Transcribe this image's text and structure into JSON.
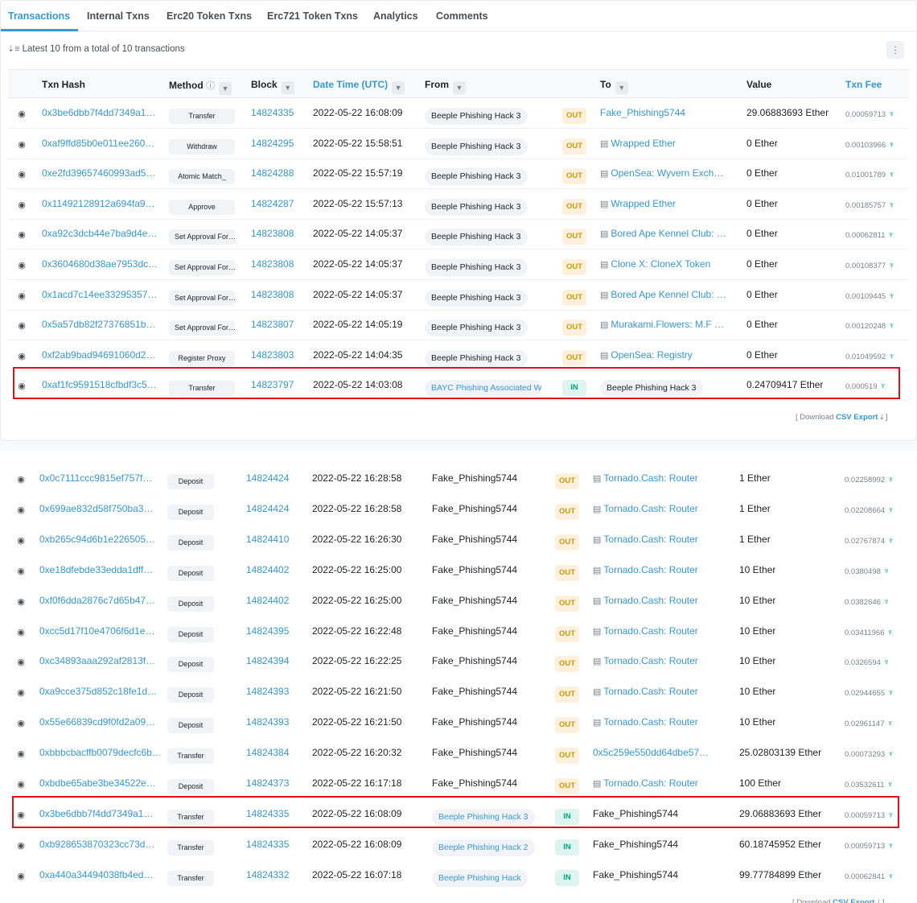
{
  "tabs": [
    "Transactions",
    "Internal Txns",
    "Erc20 Token Txns",
    "Erc721 Token Txns",
    "Analytics",
    "Comments"
  ],
  "summary": "Latest 10 from a total of 10 transactions",
  "headers": {
    "txn_hash": "Txn Hash",
    "method": "Method",
    "block": "Block",
    "datetime": "Date Time (UTC)",
    "from": "From",
    "to": "To",
    "value": "Value",
    "txn_fee": "Txn Fee"
  },
  "download": {
    "prefix": "[ Download",
    "csv": "CSV Export",
    "suffix": "]"
  },
  "colors": {
    "link": "#3498db",
    "out_badge": "#cc9a06",
    "in_badge": "#00a186",
    "highlight": "#e0101a"
  },
  "table1": [
    {
      "hash": "0x3be6dbb7f4dd7349a1…",
      "method": "Transfer",
      "block": "14824335",
      "datetime": "2022-05-22 16:08:09",
      "from": "Beeple Phishing Hack 3",
      "dir": "OUT",
      "to": "Fake_Phishing5744",
      "to_contract": false,
      "value": "29.06883693 Ether",
      "fee": "0.00059713"
    },
    {
      "hash": "0xaf9ffd85b0e011ee260…",
      "method": "Withdraw",
      "block": "14824295",
      "datetime": "2022-05-22 15:58:51",
      "from": "Beeple Phishing Hack 3",
      "dir": "OUT",
      "to": "Wrapped Ether",
      "to_contract": true,
      "value": "0 Ether",
      "fee": "0.00103966"
    },
    {
      "hash": "0xe2fd39657460993ad5…",
      "method": "Atomic Match_",
      "block": "14824288",
      "datetime": "2022-05-22 15:57:19",
      "from": "Beeple Phishing Hack 3",
      "dir": "OUT",
      "to": "OpenSea: Wyvern Exch…",
      "to_contract": true,
      "value": "0 Ether",
      "fee": "0.01001789"
    },
    {
      "hash": "0x11492128912a694fa9…",
      "method": "Approve",
      "block": "14824287",
      "datetime": "2022-05-22 15:57:13",
      "from": "Beeple Phishing Hack 3",
      "dir": "OUT",
      "to": "Wrapped Ether",
      "to_contract": true,
      "value": "0 Ether",
      "fee": "0.00185757"
    },
    {
      "hash": "0xa92c3dcb44e7ba9d4e…",
      "method": "Set Approval For…",
      "block": "14823808",
      "datetime": "2022-05-22 14:05:37",
      "from": "Beeple Phishing Hack 3",
      "dir": "OUT",
      "to": "Bored Ape Kennel Club: …",
      "to_contract": true,
      "value": "0 Ether",
      "fee": "0.00062811"
    },
    {
      "hash": "0x3604680d38ae7953dc…",
      "method": "Set Approval For…",
      "block": "14823808",
      "datetime": "2022-05-22 14:05:37",
      "from": "Beeple Phishing Hack 3",
      "dir": "OUT",
      "to": "Clone X: CloneX Token",
      "to_contract": true,
      "value": "0 Ether",
      "fee": "0.00108377"
    },
    {
      "hash": "0x1acd7c14ee33295357…",
      "method": "Set Approval For…",
      "block": "14823808",
      "datetime": "2022-05-22 14:05:37",
      "from": "Beeple Phishing Hack 3",
      "dir": "OUT",
      "to": "Bored Ape Kennel Club: …",
      "to_contract": true,
      "value": "0 Ether",
      "fee": "0.00109445"
    },
    {
      "hash": "0x5a57db82f27376851b…",
      "method": "Set Approval For…",
      "block": "14823807",
      "datetime": "2022-05-22 14:05:19",
      "from": "Beeple Phishing Hack 3",
      "dir": "OUT",
      "to": "Murakami.Flowers: M.F …",
      "to_contract": true,
      "value": "0 Ether",
      "fee": "0.00120248"
    },
    {
      "hash": "0xf2ab9bad94691060d2…",
      "method": "Register Proxy",
      "block": "14823803",
      "datetime": "2022-05-22 14:04:35",
      "from": "Beeple Phishing Hack 3",
      "dir": "OUT",
      "to": "OpenSea: Registry",
      "to_contract": true,
      "value": "0 Ether",
      "fee": "0.01049592"
    },
    {
      "hash": "0xaf1fc9591518cfbdf3c5…",
      "method": "Transfer",
      "block": "14823797",
      "datetime": "2022-05-22 14:03:08",
      "from": "BAYC Phishing Associated W…",
      "from_link": true,
      "dir": "IN",
      "to": "Beeple Phishing Hack 3",
      "to_pill": true,
      "value": "0.24709417 Ether",
      "fee": "0.000519",
      "highlight": true
    }
  ],
  "table2": [
    {
      "hash": "0x0c7111ccc9815ef757f…",
      "method": "Deposit",
      "block": "14824424",
      "datetime": "2022-05-22 16:28:58",
      "from": "Fake_Phishing5744",
      "dir": "OUT",
      "to": "Tornado.Cash: Router",
      "to_contract": true,
      "value": "1 Ether",
      "fee": "0.02258992"
    },
    {
      "hash": "0x699ae832d58f750ba3…",
      "method": "Deposit",
      "block": "14824424",
      "datetime": "2022-05-22 16:28:58",
      "from": "Fake_Phishing5744",
      "dir": "OUT",
      "to": "Tornado.Cash: Router",
      "to_contract": true,
      "value": "1 Ether",
      "fee": "0.02208664"
    },
    {
      "hash": "0xb265c94d6b1e226505…",
      "method": "Deposit",
      "block": "14824410",
      "datetime": "2022-05-22 16:26:30",
      "from": "Fake_Phishing5744",
      "dir": "OUT",
      "to": "Tornado.Cash: Router",
      "to_contract": true,
      "value": "1 Ether",
      "fee": "0.02767874"
    },
    {
      "hash": "0xe18dfebde33edda1dff…",
      "method": "Deposit",
      "block": "14824402",
      "datetime": "2022-05-22 16:25:00",
      "from": "Fake_Phishing5744",
      "dir": "OUT",
      "to": "Tornado.Cash: Router",
      "to_contract": true,
      "value": "10 Ether",
      "fee": "0.0380498"
    },
    {
      "hash": "0xf0f6dda2876c7d65b47…",
      "method": "Deposit",
      "block": "14824402",
      "datetime": "2022-05-22 16:25:00",
      "from": "Fake_Phishing5744",
      "dir": "OUT",
      "to": "Tornado.Cash: Router",
      "to_contract": true,
      "value": "10 Ether",
      "fee": "0.0382646"
    },
    {
      "hash": "0xcc5d17f10e4706f6d1e…",
      "method": "Deposit",
      "block": "14824395",
      "datetime": "2022-05-22 16:22:48",
      "from": "Fake_Phishing5744",
      "dir": "OUT",
      "to": "Tornado.Cash: Router",
      "to_contract": true,
      "value": "10 Ether",
      "fee": "0.03411966"
    },
    {
      "hash": "0xc34893aaa292af2813f…",
      "method": "Deposit",
      "block": "14824394",
      "datetime": "2022-05-22 16:22:25",
      "from": "Fake_Phishing5744",
      "dir": "OUT",
      "to": "Tornado.Cash: Router",
      "to_contract": true,
      "value": "10 Ether",
      "fee": "0.0326594"
    },
    {
      "hash": "0xa9cce375d852c18fe1d…",
      "method": "Deposit",
      "block": "14824393",
      "datetime": "2022-05-22 16:21:50",
      "from": "Fake_Phishing5744",
      "dir": "OUT",
      "to": "Tornado.Cash: Router",
      "to_contract": true,
      "value": "10 Ether",
      "fee": "0.02944655"
    },
    {
      "hash": "0x55e66839cd9f0fd2a09…",
      "method": "Deposit",
      "block": "14824393",
      "datetime": "2022-05-22 16:21:50",
      "from": "Fake_Phishing5744",
      "dir": "OUT",
      "to": "Tornado.Cash: Router",
      "to_contract": true,
      "value": "10 Ether",
      "fee": "0.02961147"
    },
    {
      "hash": "0xbbbcbacffb0079decfc6b…",
      "method": "Transfer",
      "block": "14824384",
      "datetime": "2022-05-22 16:20:32",
      "from": "Fake_Phishing5744",
      "dir": "OUT",
      "to": "0x5c259e550dd64dbe57…",
      "to_contract": false,
      "value": "25.02803139 Ether",
      "fee": "0.00073293"
    },
    {
      "hash": "0xbdbe65abe3be34522e…",
      "method": "Deposit",
      "block": "14824373",
      "datetime": "2022-05-22 16:17:18",
      "from": "Fake_Phishing5744",
      "dir": "OUT",
      "to": "Tornado.Cash: Router",
      "to_contract": true,
      "value": "100 Ether",
      "fee": "0.03532611"
    },
    {
      "hash": "0x3be6dbb7f4dd7349a1…",
      "method": "Transfer",
      "block": "14824335",
      "datetime": "2022-05-22 16:08:09",
      "from": "Beeple Phishing Hack 3",
      "from_pill_link": true,
      "dir": "IN",
      "to": "Fake_Phishing5744",
      "to_dark": true,
      "value": "29.06883693 Ether",
      "fee": "0.00059713",
      "highlight": true
    },
    {
      "hash": "0xb928653870323cc73d…",
      "method": "Transfer",
      "block": "14824335",
      "datetime": "2022-05-22 16:08:09",
      "from": "Beeple Phishing Hack 2",
      "from_pill_link": true,
      "dir": "IN",
      "to": "Fake_Phishing5744",
      "to_dark": true,
      "value": "60.18745952 Ether",
      "fee": "0.00059713"
    },
    {
      "hash": "0xa440a34494038fb4ed…",
      "method": "Transfer",
      "block": "14824332",
      "datetime": "2022-05-22 16:07:18",
      "from": "Beeple Phishing Hack",
      "from_pill_link": true,
      "dir": "IN",
      "to": "Fake_Phishing5744",
      "to_dark": true,
      "value": "99.77784899 Ether",
      "fee": "0.00062841"
    }
  ]
}
